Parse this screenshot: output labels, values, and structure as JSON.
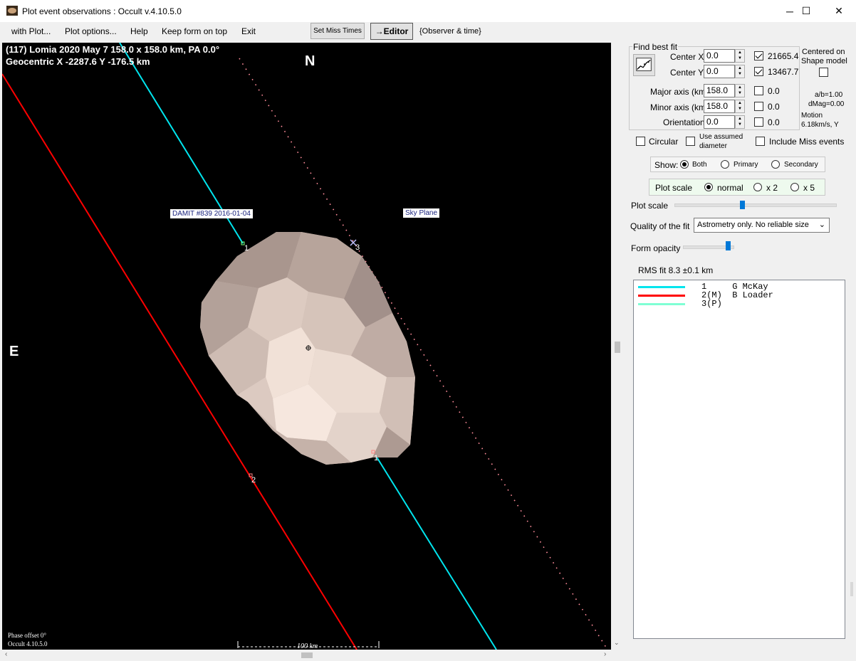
{
  "window": {
    "title": "Plot event observations : Occult v.4.10.5.0",
    "minimize": "─",
    "maximize": "☐",
    "close": "✕"
  },
  "menu": [
    {
      "label": "with Plot..."
    },
    {
      "label": "Plot options..."
    },
    {
      "label": "Help"
    },
    {
      "label": "Keep form on top"
    },
    {
      "label": "Exit"
    }
  ],
  "toolbar": {
    "set_miss_times": "Set Miss Times",
    "editor": "→Editor",
    "observer_time": "{Observer & time}"
  },
  "plot": {
    "header_line1": "(117) Lomia  2020 May 7   158.0 x 158.0 km, PA 0.0°",
    "header_line2": "Geocentric  X  -2287.6  Y  -176.5 km",
    "north": "N",
    "east": "E",
    "damit_label": "DAMIT #839 2016-01-04",
    "sky_plane_label": "Sky Plane",
    "chord_labels": [
      "1",
      "2",
      "3",
      "1"
    ],
    "phase_offset": "Phase offset 0°",
    "version": "Occult 4.10.5.0",
    "scale_label": "100 km",
    "colors": {
      "chord1": "#00e5ee",
      "chord2": "#ff0000",
      "chord3": "#ff8c9a",
      "shape": "#d9c9c0"
    }
  },
  "panel": {
    "find_best_fit": "Find best fit",
    "center_x_label": "Center X",
    "center_x_value": "0.0",
    "center_y_label": "Center Y",
    "center_y_value": "0.0",
    "check_x_value": "21665.4",
    "check_y_value": "13467.7",
    "centered_on": "Centered on",
    "shape_model": "Shape model",
    "major_axis_label": "Major axis (km)",
    "major_axis_value": "158.0",
    "minor_axis_label": "Minor axis (km)",
    "minor_axis_value": "158.0",
    "orientation_label": "Orientation",
    "orientation_value": "0.0",
    "fit_major": "0.0",
    "fit_minor": "0.0",
    "fit_orient": "0.0",
    "ab_ratio": "a/b=1.00",
    "dmag": "dMag=0.00",
    "motion_label": "Motion",
    "motion_value": "6.18km/s, Y",
    "circular": "Circular",
    "use_assumed": "Use assumed",
    "diameter": "diameter",
    "include_miss": "Include Miss events",
    "show_label": "Show:",
    "show_both": "Both",
    "show_primary": "Primary",
    "show_secondary": "Secondary",
    "plot_scale_group": "Plot scale",
    "scale_normal": "normal",
    "scale_x2": "x 2",
    "scale_x5": "x 5",
    "plot_scale_slider": "Plot scale",
    "plot_scale_level": 0.42,
    "quality_label": "Quality of the fit",
    "quality_value": "Astrometry only. No reliable size",
    "form_opacity": "Form opacity",
    "form_opacity_level": 0.95,
    "rms_fit": "RMS fit 8.3 ±0.1 km"
  },
  "legend": [
    {
      "text": "1     G McKay",
      "color": "#00e5ee"
    },
    {
      "text": "2(M)  B Loader",
      "color": "#ff0000"
    },
    {
      "text": "3(P)",
      "color": "#7fffd4"
    }
  ]
}
